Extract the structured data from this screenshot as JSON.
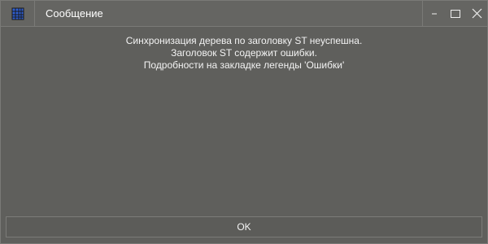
{
  "window": {
    "title": "Сообщение",
    "app_icon": "grid-app-icon",
    "controls": {
      "minimize_icon": "minimize-icon",
      "maximize_icon": "maximize-icon",
      "close_icon": "close-icon"
    }
  },
  "message": {
    "line1": "Синхронизация дерева по заголовку ST неуспешна.",
    "line2": "Заголовок ST содержит ошибки.",
    "line3": "Подробности на закладке легенды 'Ошибки'"
  },
  "buttons": {
    "ok_label": "OK"
  },
  "colors": {
    "background": "#5f5f5c",
    "titlebar": "#656562",
    "text": "#f3f3f3",
    "border": "#7a7a77",
    "icon_blue": "#2f5fd2"
  }
}
